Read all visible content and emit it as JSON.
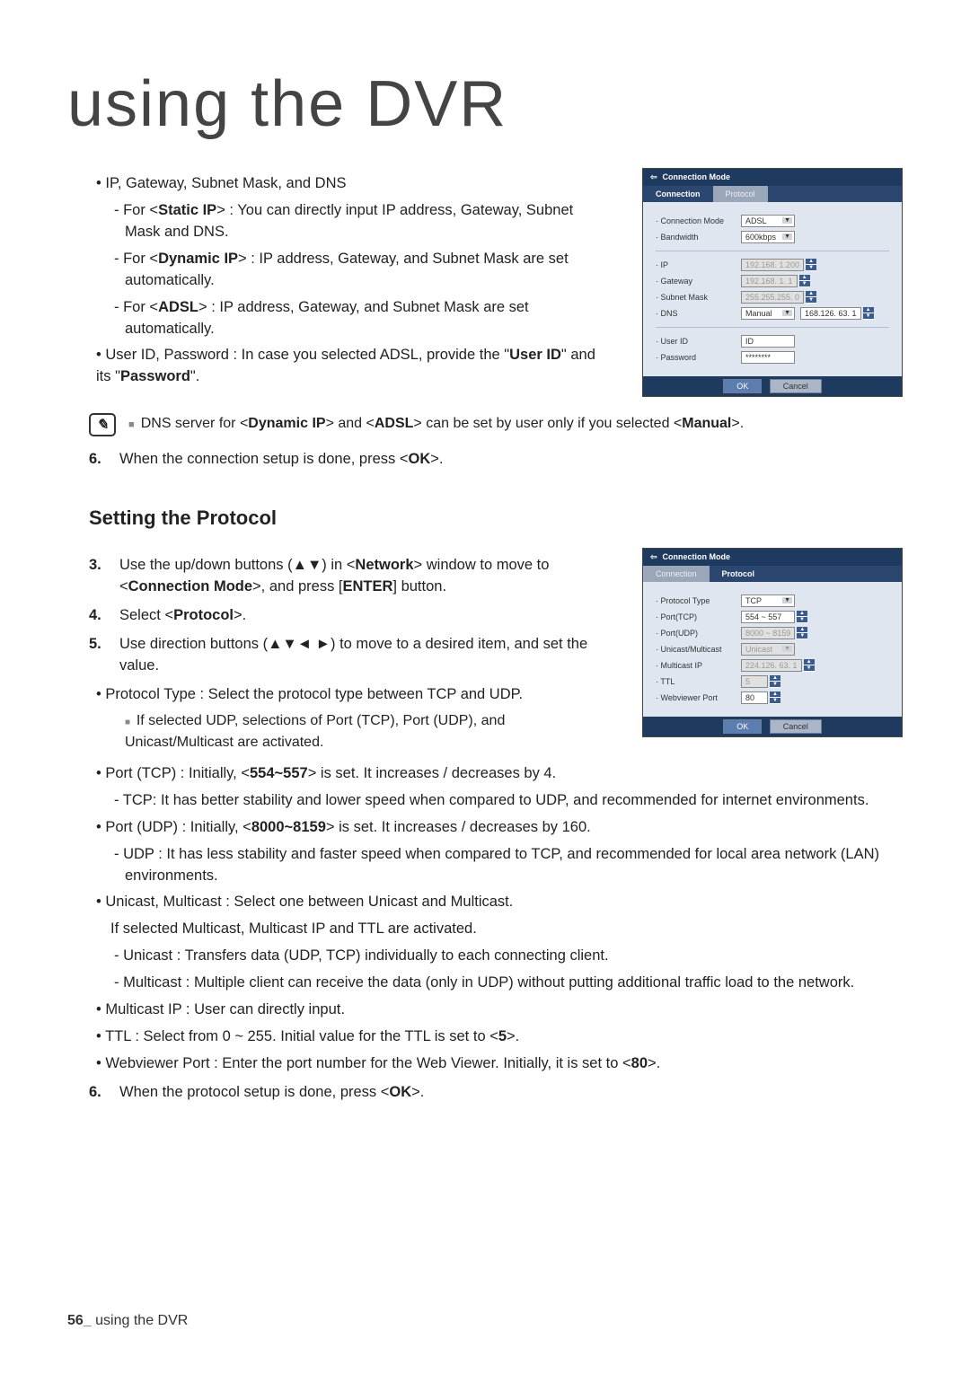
{
  "page": {
    "title": "using the DVR",
    "footer_page": "56_",
    "footer_text": "using the DVR"
  },
  "section1": {
    "b1": "IP, Gateway, Subnet Mask, and DNS",
    "b1a_pre": "For <",
    "b1a_bold": "Static IP",
    "b1a_post": "> : You can directly input IP address, Gateway, Subnet Mask and DNS.",
    "b1b_pre": "For <",
    "b1b_bold": "Dynamic IP",
    "b1b_post": "> : IP address, Gateway, and Subnet Mask are set automatically.",
    "b1c_pre": "For <",
    "b1c_bold": "ADSL",
    "b1c_post": "> : IP address, Gateway, and Subnet Mask are set automatically.",
    "b2_pre": "User ID, Password : In case you selected ADSL, provide the \"",
    "b2_b1": "User ID",
    "b2_mid": "\" and its \"",
    "b2_b2": "Password",
    "b2_post": "\".",
    "note_pre": "DNS server for <",
    "note_b1": "Dynamic IP",
    "note_mid1": "> and <",
    "note_b2": "ADSL",
    "note_mid2": "> can be set by user only if you selected <",
    "note_b3": "Manual",
    "note_post": ">.",
    "step6_num": "6.",
    "step6_pre": "When the connection setup is done, press <",
    "step6_bold": "OK",
    "step6_post": ">."
  },
  "section2": {
    "heading": "Setting the Protocol",
    "s3_num": "3.",
    "s3_pre": "Use the up/down buttons (▲▼) in <",
    "s3_b1": "Network",
    "s3_mid1": "> window to move to <",
    "s3_b2": "Connection Mode",
    "s3_mid2": ">, and press [",
    "s3_b3": "ENTER",
    "s3_post": "] button.",
    "s4_num": "4.",
    "s4_pre": "Select <",
    "s4_b1": "Protocol",
    "s4_post": ">.",
    "s5_num": "5.",
    "s5": "Use direction buttons (▲▼◄ ►) to move to a desired item, and set the value.",
    "p_proto_type": "Protocol Type : Select the protocol type between TCP and UDP.",
    "p_proto_note": "If selected UDP, selections of Port (TCP), Port (UDP), and Unicast/Multicast are activated.",
    "p_tcp_pre": "Port (TCP) : Initially, <",
    "p_tcp_b": "554~557",
    "p_tcp_post": "> is set. It increases / decreases by 4.",
    "p_tcp_sub": "TCP: It has better stability and lower speed when compared to UDP, and recommended for internet environments.",
    "p_udp_pre": "Port (UDP) : Initially, <",
    "p_udp_b": "8000~8159",
    "p_udp_post": "> is set. It increases / decreases by 160.",
    "p_udp_sub": "UDP : It has less stability and faster speed when compared to TCP, and recommended for local area network (LAN) environments.",
    "p_unim": "Unicast, Multicast : Select one between Unicast and Multicast.",
    "p_unim2": "If selected Multicast, Multicast IP and TTL are activated.",
    "p_unim_a": "Unicast : Transfers data (UDP, TCP) individually to each connecting client.",
    "p_unim_b": "Multicast : Multiple client can receive the data (only in UDP) without putting additional traffic load to the network.",
    "p_mip": "Multicast IP : User can directly input.",
    "p_ttl_pre": "TTL : Select from 0 ~ 255. Initial value for the TTL is set to <",
    "p_ttl_b": "5",
    "p_ttl_post": ">.",
    "p_web_pre": "Webviewer Port : Enter the port number for the Web Viewer. Initially, it is set to <",
    "p_web_b": "80",
    "p_web_post": ">.",
    "s6_num": "6.",
    "s6_pre": "When the protocol setup is done, press <",
    "s6_b": "OK",
    "s6_post": ">."
  },
  "dialog1": {
    "title": "Connection Mode",
    "tab_a": "Connection",
    "tab_b": "Protocol",
    "rows": {
      "conn_mode_lab": "Connection Mode",
      "conn_mode_val": "ADSL",
      "bw_lab": "Bandwidth",
      "bw_val": "600kbps",
      "ip_lab": "IP",
      "ip_val": "192.168. 1.200",
      "gw_lab": "Gateway",
      "gw_val": "192.168. 1. 1",
      "sm_lab": "Subnet Mask",
      "sm_val": "255.255.255. 0",
      "dns_lab": "DNS",
      "dns_mode": "Manual",
      "dns_val": "168.126. 63. 1",
      "uid_lab": "User ID",
      "uid_val": "ID",
      "pwd_lab": "Password",
      "pwd_val": "********"
    },
    "ok": "OK",
    "cancel": "Cancel"
  },
  "dialog2": {
    "title": "Connection Mode",
    "tab_a": "Connection",
    "tab_b": "Protocol",
    "rows": {
      "pt_lab": "Protocol Type",
      "pt_val": "TCP",
      "ptcp_lab": "Port(TCP)",
      "ptcp_val": "554 ~ 557",
      "pudp_lab": "Port(UDP)",
      "pudp_val": "8000 ~ 8159",
      "um_lab": "Unicast/Multicast",
      "um_val": "Unicast",
      "mip_lab": "Multicast IP",
      "mip_val": "224.126. 63. 1",
      "ttl_lab": "TTL",
      "ttl_val": "5",
      "web_lab": "Webviewer Port",
      "web_val": "80"
    },
    "ok": "OK",
    "cancel": "Cancel"
  }
}
